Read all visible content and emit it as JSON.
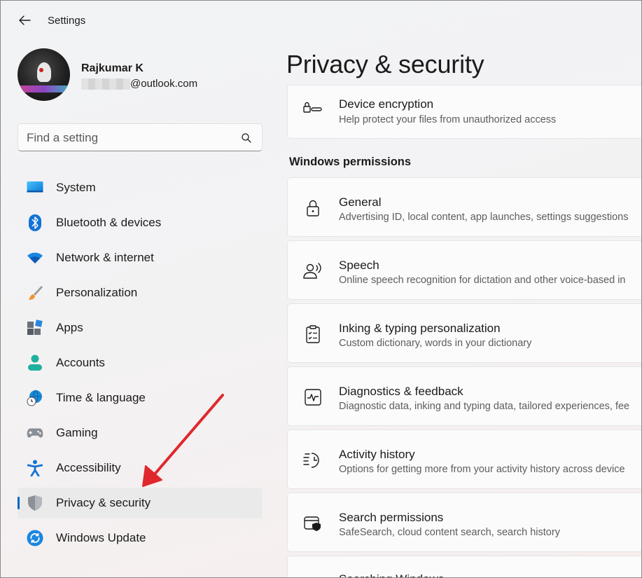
{
  "window": {
    "title": "Settings"
  },
  "profile": {
    "name": "Rajkumar K",
    "email_suffix": "@outlook.com"
  },
  "search": {
    "placeholder": "Find a setting"
  },
  "nav": [
    {
      "label": "System",
      "icon": "monitor-icon"
    },
    {
      "label": "Bluetooth & devices",
      "icon": "bluetooth-icon"
    },
    {
      "label": "Network & internet",
      "icon": "wifi-icon"
    },
    {
      "label": "Personalization",
      "icon": "paintbrush-icon"
    },
    {
      "label": "Apps",
      "icon": "apps-icon"
    },
    {
      "label": "Accounts",
      "icon": "person-icon"
    },
    {
      "label": "Time & language",
      "icon": "globe-clock-icon"
    },
    {
      "label": "Gaming",
      "icon": "gamepad-icon"
    },
    {
      "label": "Accessibility",
      "icon": "accessibility-icon"
    },
    {
      "label": "Privacy & security",
      "icon": "shield-icon",
      "selected": true
    },
    {
      "label": "Windows Update",
      "icon": "update-icon"
    }
  ],
  "main": {
    "title": "Privacy & security",
    "top_card": {
      "title": "Device encryption",
      "subtitle": "Help protect your files from unauthorized access",
      "icon": "encryption-key-icon"
    },
    "section": "Windows permissions",
    "cards": [
      {
        "title": "General",
        "subtitle": "Advertising ID, local content, app launches, settings suggestions",
        "icon": "lock-icon"
      },
      {
        "title": "Speech",
        "subtitle": "Online speech recognition for dictation and other voice-based in",
        "icon": "speech-icon"
      },
      {
        "title": "Inking & typing personalization",
        "subtitle": "Custom dictionary, words in your dictionary",
        "icon": "clipboard-checklist-icon"
      },
      {
        "title": "Diagnostics & feedback",
        "subtitle": "Diagnostic data, inking and typing data, tailored experiences, fee",
        "icon": "pulse-icon"
      },
      {
        "title": "Activity history",
        "subtitle": "Options for getting more from your activity history across device",
        "icon": "history-icon"
      },
      {
        "title": "Search permissions",
        "subtitle": "SafeSearch, cloud content search, search history",
        "icon": "search-shield-icon"
      },
      {
        "title": "Searching Windows",
        "subtitle": "",
        "icon": "search-icon"
      }
    ]
  },
  "colors": {
    "accent": "#0067c0",
    "annotation_arrow": "#e0282c"
  }
}
